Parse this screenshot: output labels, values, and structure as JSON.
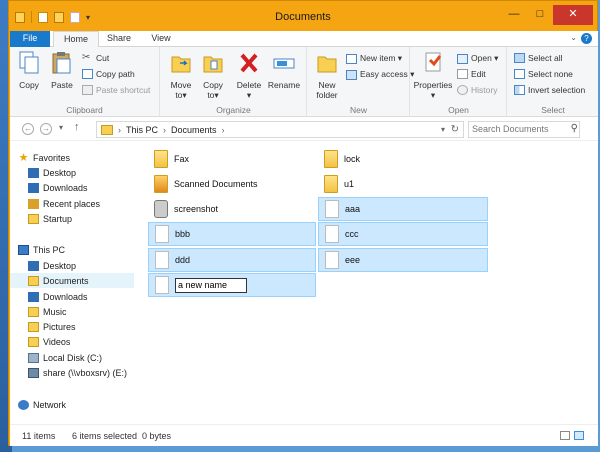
{
  "window": {
    "title": "Documents"
  },
  "tabs": [
    {
      "label": "File"
    },
    {
      "label": "Home"
    },
    {
      "label": "Share"
    },
    {
      "label": "View"
    }
  ],
  "ribbon": {
    "clipboard": {
      "label": "Clipboard",
      "copy": "Copy",
      "paste": "Paste",
      "cut": "Cut",
      "copy_path": "Copy path",
      "paste_shortcut": "Paste shortcut"
    },
    "organize": {
      "label": "Organize",
      "move_to": [
        "Move",
        "to▾"
      ],
      "copy_to": [
        "Copy",
        "to▾"
      ],
      "delete": [
        "Delete",
        "▾"
      ],
      "rename": "Rename"
    },
    "new": {
      "label": "New",
      "new_folder": [
        "New",
        "folder"
      ],
      "new_item": "New item ▾",
      "easy_access": "Easy access ▾"
    },
    "open": {
      "label": "Open",
      "properties": [
        "Properties",
        "▾"
      ],
      "open": "Open ▾",
      "edit": "Edit",
      "history": "History"
    },
    "select": {
      "label": "Select",
      "select_all": "Select all",
      "select_none": "Select none",
      "invert_selection": "Invert selection"
    }
  },
  "address": {
    "crumbs": [
      "This PC",
      "Documents"
    ],
    "search_placeholder": "Search Documents"
  },
  "navpane": {
    "favorites": {
      "label": "Favorites",
      "items": [
        "Desktop",
        "Downloads",
        "Recent places",
        "Startup"
      ]
    },
    "thispc": {
      "label": "This PC",
      "items": [
        "Desktop",
        "Documents",
        "Downloads",
        "Music",
        "Pictures",
        "Videos",
        "Local Disk (C:)",
        "share (\\\\vboxsrv) (E:)"
      ]
    },
    "network": "Network",
    "selected": "Documents"
  },
  "files": {
    "left": [
      {
        "name": "Fax",
        "type": "folder",
        "selected": false
      },
      {
        "name": "Scanned Documents",
        "type": "folder",
        "selected": false
      },
      {
        "name": "screenshot",
        "type": "app",
        "selected": false
      },
      {
        "name": "bbb",
        "type": "file",
        "selected": true
      },
      {
        "name": "ddd",
        "type": "file",
        "selected": true
      }
    ],
    "right": [
      {
        "name": "lock",
        "type": "folder",
        "selected": false
      },
      {
        "name": "u1",
        "type": "folder",
        "selected": false
      },
      {
        "name": "aaa",
        "type": "file",
        "selected": true
      },
      {
        "name": "ccc",
        "type": "file",
        "selected": true
      },
      {
        "name": "eee",
        "type": "file",
        "selected": true
      }
    ],
    "rename_value": "a new name"
  },
  "status": {
    "count": "11 items",
    "selection": "6 items selected  0 bytes"
  }
}
